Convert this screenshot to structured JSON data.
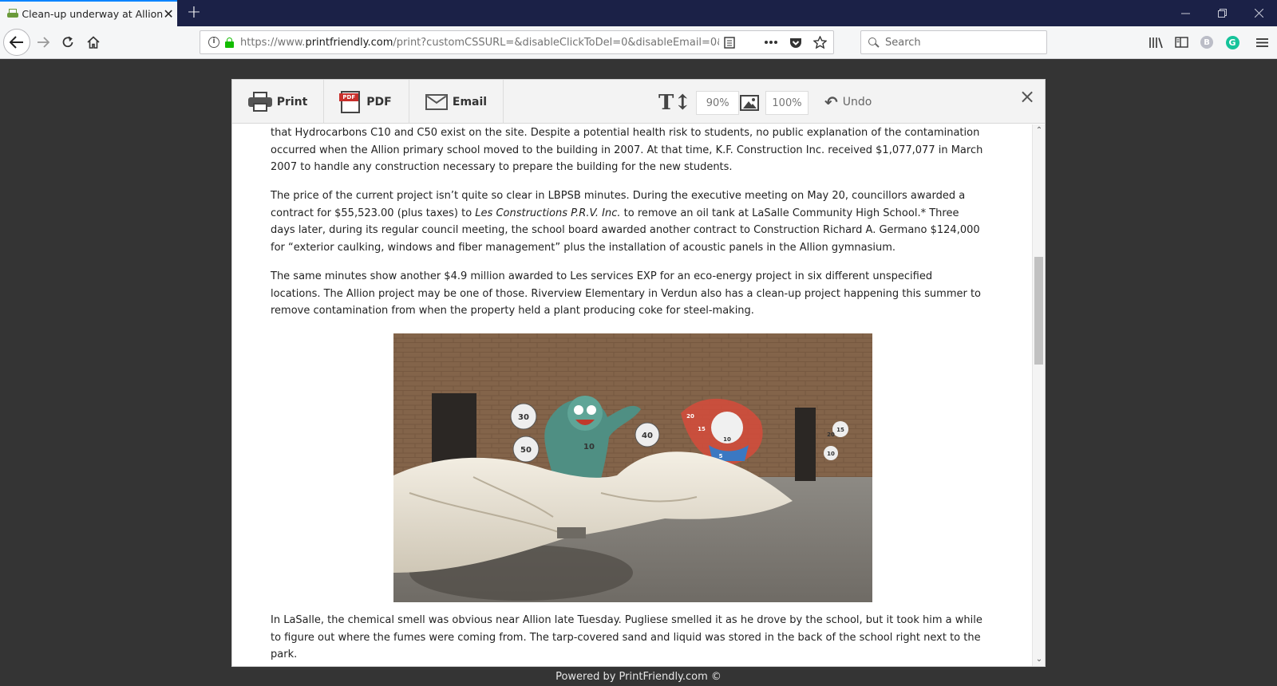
{
  "browser": {
    "tab_title": "Clean-up underway at Allion",
    "url_prefix": "https://www.",
    "url_domain": "printfriendly.com",
    "url_rest": "/print?customCSSURL=&disableClickToDel=0&disableEmail=0&disab",
    "search_placeholder": "Search",
    "ext_b_label": "B",
    "ext_g_label": "G"
  },
  "toolbar": {
    "print_label": "Print",
    "pdf_label": "PDF",
    "pdf_badge": "PDF",
    "email_label": "Email",
    "text_size": "90%",
    "image_size": "100%",
    "undo_label": "Undo"
  },
  "article": {
    "para1": "that Hydrocarbons C10 and C50 exist on the site. Despite a potential health risk to students, no public explanation of the contamination occurred when the Allion primary school moved to the building in 2007. At that time, K.F. Construction Inc. received $1,077,077 in March 2007 to handle any construction necessary to prepare the building for the new students.",
    "para2_a": "The price of the current project isn’t quite so clear in LBPSB minutes. During the executive meeting on May 20, councillors awarded a contract for $55,523.00 (plus taxes) to ",
    "para2_em": "Les Constructions P.R.V. Inc.",
    "para2_b": " to remove an oil tank at LaSalle Community High School.* Three days later, during its regular council meeting, the school board awarded another contract to Construction Richard A. Germano $124,000 for “exterior caulking, windows and fiber management” plus the installation of acoustic panels in the Allion gymnasium.",
    "para3": "The same minutes show another $4.9 million awarded to Les services EXP for an eco-energy project in six different unspecified locations. The Allion project may be one of those. Riverview Elementary in Verdun also has a clean-up project happening this summer to remove contamination from when the property held a plant producing coke for steel-making.",
    "para4": "In LaSalle, the chemical smell was obvious near Allion late Tuesday. Pugliese smelled it as he drove by the school, but it took him a while to figure out where the fumes were coming from. The tarp-covered sand and liquid was stored in the back of the school right next to the park.",
    "mural_numbers": [
      "30",
      "50",
      "40",
      "10",
      "20",
      "15",
      "10",
      "5",
      "20",
      "15",
      "10"
    ]
  },
  "footer": {
    "powered_by": "Powered by PrintFriendly.com ©"
  }
}
